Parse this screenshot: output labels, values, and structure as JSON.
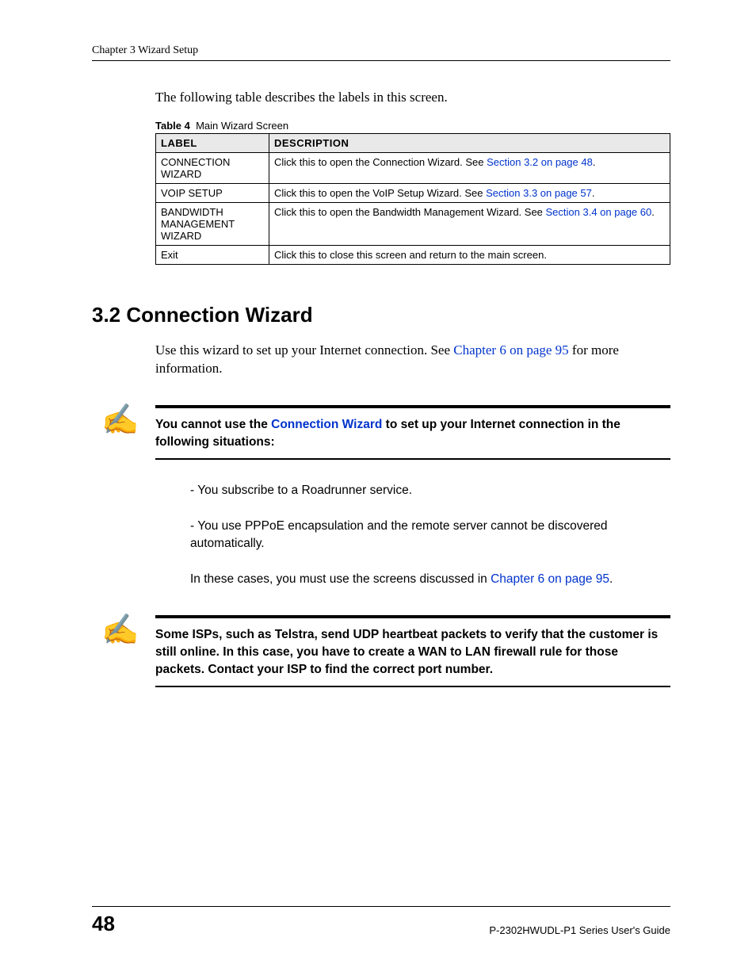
{
  "header": {
    "chapter": "Chapter 3 Wizard Setup"
  },
  "intro_text": "The following table describes the labels in this screen.",
  "table": {
    "caption_prefix": "Table 4",
    "caption_title": "Main Wizard Screen",
    "headers": {
      "label": "LABEL",
      "description": "DESCRIPTION"
    },
    "rows": [
      {
        "label": "CONNECTION WIZARD",
        "desc_pre": "Click this to open the Connection Wizard. See ",
        "desc_link": "Section 3.2 on page 48",
        "desc_post": "."
      },
      {
        "label": "VOIP SETUP",
        "desc_pre": "Click this to open the VoIP Setup Wizard. See ",
        "desc_link": "Section 3.3 on page 57",
        "desc_post": "."
      },
      {
        "label": "BANDWIDTH MANAGEMENT WIZARD",
        "desc_pre": "Click this to open the Bandwidth Management Wizard. See ",
        "desc_link": "Section 3.4 on page 60",
        "desc_post": "."
      },
      {
        "label": "Exit",
        "desc_pre": "Click this to close this screen and return to the main screen.",
        "desc_link": "",
        "desc_post": ""
      }
    ]
  },
  "section": {
    "heading": "3.2  Connection Wizard",
    "intro_pre": "Use this wizard to set up your Internet connection. See ",
    "intro_link": "Chapter 6 on page 95",
    "intro_post": " for more information."
  },
  "note1": {
    "pre": "You cannot use the ",
    "link": "Connection Wizard",
    "post": " to set up your Internet connection in the following situations:"
  },
  "bullets": {
    "b1": "- You subscribe to a Roadrunner service.",
    "b2": "- You use PPPoE encapsulation and the remote server cannot be discovered automatically.",
    "closing_pre": "In these cases, you must use the screens discussed in ",
    "closing_link": "Chapter 6 on page 95",
    "closing_post": "."
  },
  "note2": {
    "text": "Some ISPs, such as Telstra, send UDP heartbeat packets to verify that the customer is still online. In this case, you have to create a WAN to LAN firewall rule for those packets. Contact your ISP to find the correct port number."
  },
  "footer": {
    "page": "48",
    "doc_title": "P-2302HWUDL-P1 Series User's Guide"
  },
  "icons": {
    "note": "✍"
  }
}
